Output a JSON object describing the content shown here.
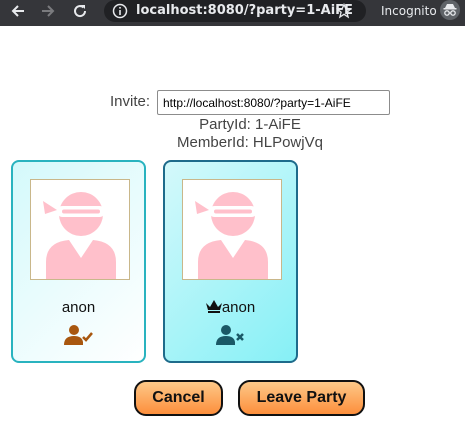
{
  "browser": {
    "url": "localhost:8080/?party=1-AiFE",
    "mode_label": "Incognito"
  },
  "invite": {
    "label": "Invite:",
    "value": "http://localhost:8080/?party=1-AiFE"
  },
  "party_id_text": "PartyId: 1-AiFE",
  "member_id_text": "MemberId: HLPowjVq",
  "members": [
    {
      "name": "anon",
      "status_icon": "user-check-icon",
      "is_host": false,
      "status_color": "#a8570f"
    },
    {
      "name": "anon",
      "status_icon": "user-x-icon",
      "is_host": true,
      "status_color": "#1a5866"
    }
  ],
  "buttons": {
    "cancel": "Cancel",
    "leave": "Leave Party"
  },
  "colors": {
    "card_border": "#29b3bf",
    "button_gradient_top": "#fdc888",
    "button_gradient_bottom": "#fd8f3c",
    "avatar_pink": "#ffc0cb"
  }
}
